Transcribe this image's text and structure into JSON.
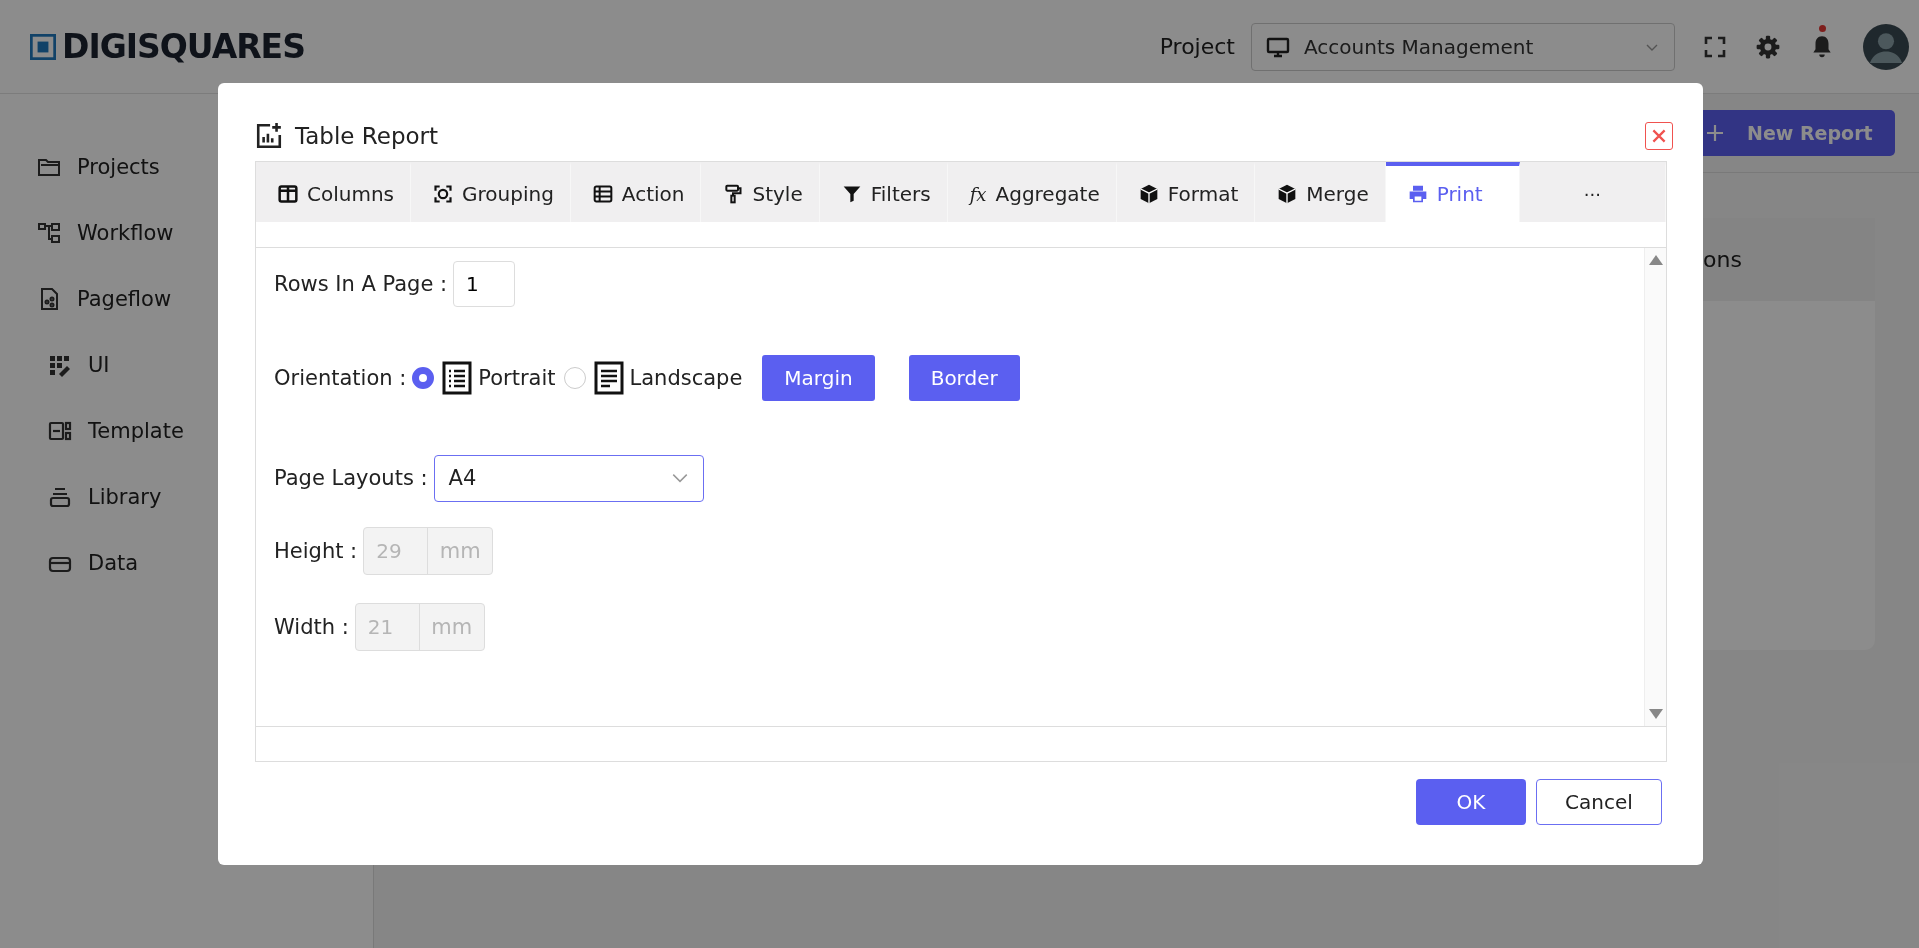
{
  "header": {
    "logo": "DIGISQUARES",
    "project_label": "Project",
    "project_value": "Accounts Management",
    "notification": true
  },
  "sidebar": {
    "items": [
      {
        "label": "Projects",
        "indented": false
      },
      {
        "label": "Workflow",
        "indented": false
      },
      {
        "label": "Pageflow",
        "indented": false
      },
      {
        "label": "UI",
        "indented": true
      },
      {
        "label": "Template",
        "indented": true
      },
      {
        "label": "Library",
        "indented": true
      },
      {
        "label": "Data",
        "indented": true
      }
    ]
  },
  "toolbar": {
    "new_report_button": "New Report"
  },
  "card": {
    "header": "ons"
  },
  "dialog": {
    "title": "Table Report",
    "tabs": [
      {
        "label": "Columns",
        "selected": false
      },
      {
        "label": "Grouping",
        "selected": false
      },
      {
        "label": "Action",
        "selected": false
      },
      {
        "label": "Style",
        "selected": false
      },
      {
        "label": "Filters",
        "selected": false
      },
      {
        "label": "Aggregate",
        "selected": false,
        "glyph": "fx"
      },
      {
        "label": "Format",
        "selected": false
      },
      {
        "label": "Merge",
        "selected": false
      },
      {
        "label": "Print",
        "selected": true
      }
    ],
    "more_tab": "···",
    "rows_in_page": {
      "label": "Rows In A Page :",
      "value": "1"
    },
    "orientation": {
      "label": "Orientation :",
      "options": [
        {
          "label": "Portrait",
          "selected": true
        },
        {
          "label": "Landscape",
          "selected": false
        }
      ]
    },
    "option_buttons": [
      "Margin",
      "Border"
    ],
    "page_layouts": {
      "label": "Page Layouts :",
      "value": "A4"
    },
    "height": {
      "label": "Height :",
      "value": "29",
      "unit": "mm",
      "disabled": true
    },
    "width": {
      "label": "Width :",
      "value": "21",
      "unit": "mm",
      "disabled": true
    },
    "footer_buttons": [
      {
        "label": "OK",
        "kind": "primary"
      },
      {
        "label": "Cancel",
        "kind": "outline"
      }
    ]
  }
}
